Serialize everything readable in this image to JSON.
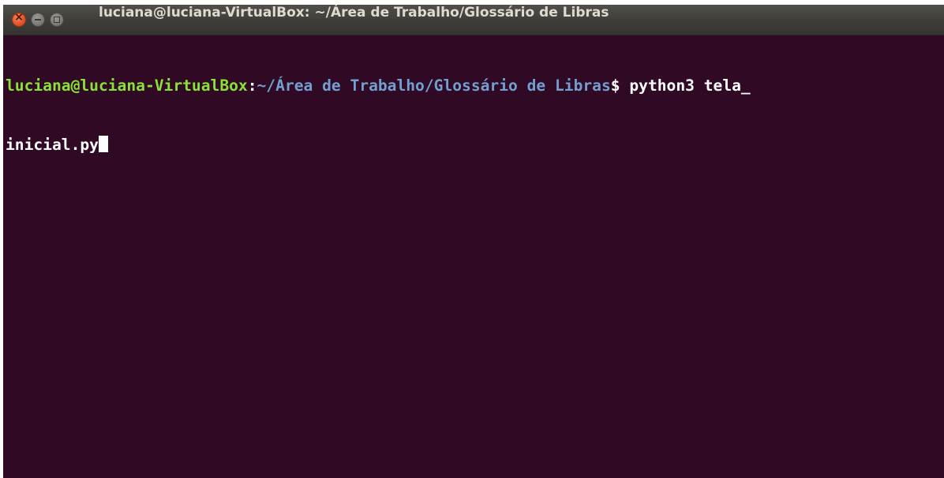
{
  "window": {
    "title": "luciana@luciana-VirtualBox: ~/Área de Trabalho/Glossário de Libras"
  },
  "terminal": {
    "user_host": "luciana@luciana-VirtualBox",
    "separator": ":",
    "path": "~/Área de Trabalho/Glossário de Libras",
    "prompt_symbol": "$",
    "command_line1": " python3 tela_",
    "command_line2": "inicial.py"
  },
  "colors": {
    "background": "#300a24",
    "user_host": "#8ae234",
    "path": "#729fcf",
    "text": "#ffffff"
  }
}
